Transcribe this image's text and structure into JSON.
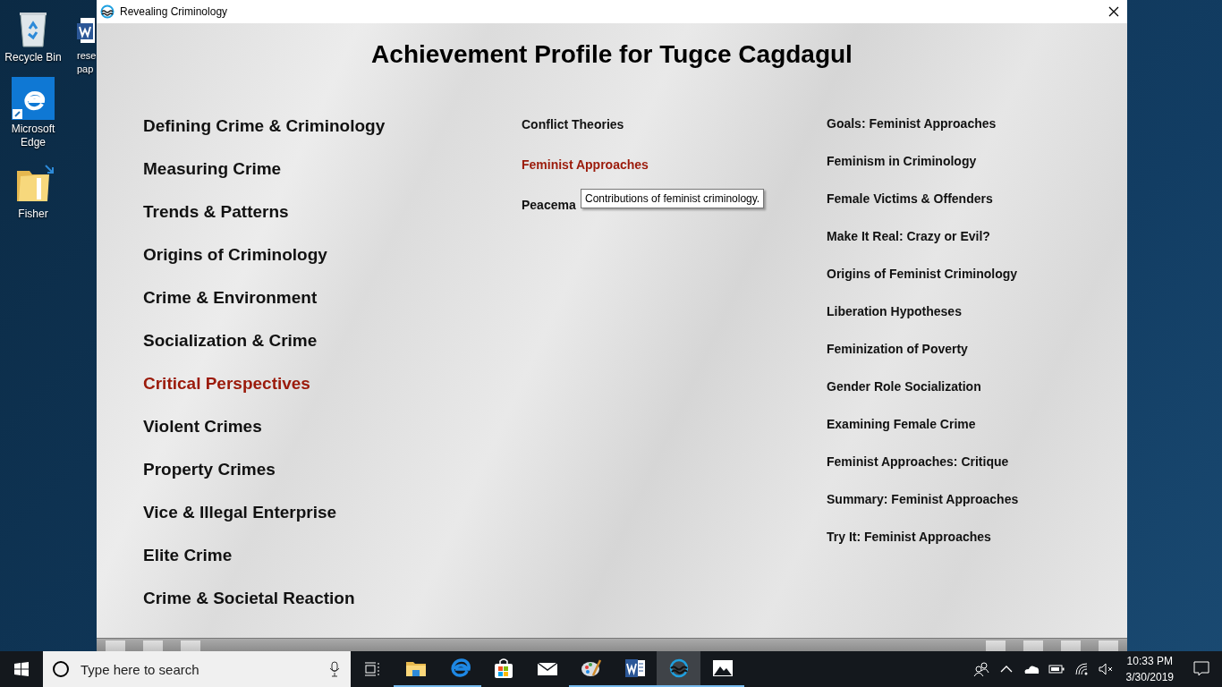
{
  "desktop": {
    "icons": [
      {
        "kind": "recycle",
        "label": "Recycle Bin"
      },
      {
        "kind": "edge",
        "label": "Microsoft Edge"
      },
      {
        "kind": "folder",
        "label": "Fisher"
      }
    ],
    "partial_icon": {
      "kind": "word",
      "label": "rese pap"
    }
  },
  "window": {
    "title": "Revealing Criminology",
    "heading": "Achievement Profile for Tugce Cagdagul",
    "chapters": [
      {
        "label": "Defining Crime & Criminology",
        "selected": false
      },
      {
        "label": "Measuring Crime",
        "selected": false
      },
      {
        "label": "Trends & Patterns",
        "selected": false
      },
      {
        "label": "Origins of Criminology",
        "selected": false
      },
      {
        "label": "Crime & Environment",
        "selected": false
      },
      {
        "label": "Socialization & Crime",
        "selected": false
      },
      {
        "label": "Critical Perspectives",
        "selected": true
      },
      {
        "label": "Violent Crimes",
        "selected": false
      },
      {
        "label": "Property Crimes",
        "selected": false
      },
      {
        "label": "Vice & Illegal Enterprise",
        "selected": false
      },
      {
        "label": "Elite Crime",
        "selected": false
      },
      {
        "label": "Crime & Societal Reaction",
        "selected": false
      }
    ],
    "sections": [
      {
        "label": "Conflict Theories",
        "selected": false
      },
      {
        "label": "Feminist Approaches",
        "selected": true
      },
      {
        "label": "Peacema",
        "selected": false
      }
    ],
    "topics": [
      {
        "label": "Goals: Feminist Approaches"
      },
      {
        "label": "Feminism in Criminology"
      },
      {
        "label": "Female Victims & Offenders"
      },
      {
        "label": "Make It Real: Crazy or Evil?"
      },
      {
        "label": "Origins of Feminist Criminology"
      },
      {
        "label": "Liberation Hypotheses"
      },
      {
        "label": "Feminization of Poverty"
      },
      {
        "label": "Gender Role Socialization"
      },
      {
        "label": "Examining Female Crime"
      },
      {
        "label": "Feminist Approaches: Critique"
      },
      {
        "label": "Summary: Feminist Approaches"
      },
      {
        "label": "Try It: Feminist Approaches"
      }
    ],
    "tooltip": "Contributions of feminist criminology."
  },
  "taskbar": {
    "search_placeholder": "Type here to search",
    "apps": [
      {
        "kind": "explorer",
        "running": true,
        "active": false
      },
      {
        "kind": "edge",
        "running": true,
        "active": false
      },
      {
        "kind": "store",
        "running": false,
        "active": false
      },
      {
        "kind": "mail",
        "running": false,
        "active": false
      },
      {
        "kind": "paint",
        "running": true,
        "active": false
      },
      {
        "kind": "word",
        "running": true,
        "active": false
      },
      {
        "kind": "criminology",
        "running": true,
        "active": true
      },
      {
        "kind": "photos",
        "running": true,
        "active": false
      }
    ],
    "time": "10:33 PM",
    "date": "3/30/2019"
  }
}
